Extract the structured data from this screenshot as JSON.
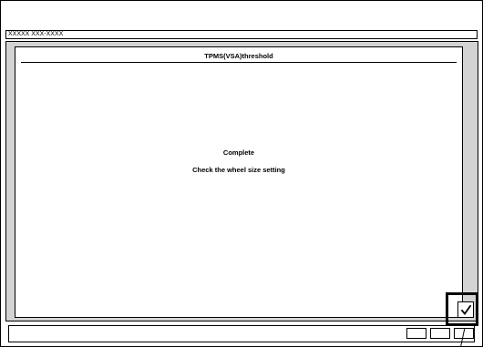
{
  "header": {
    "id_text": "XXXXX XXX-XXXX"
  },
  "panel": {
    "title": "TPMS(VSA)threshold",
    "message_line1": "Complete",
    "message_line2": "Check the wheel size setting"
  },
  "controls": {
    "confirm_icon": "checkmark-icon"
  }
}
